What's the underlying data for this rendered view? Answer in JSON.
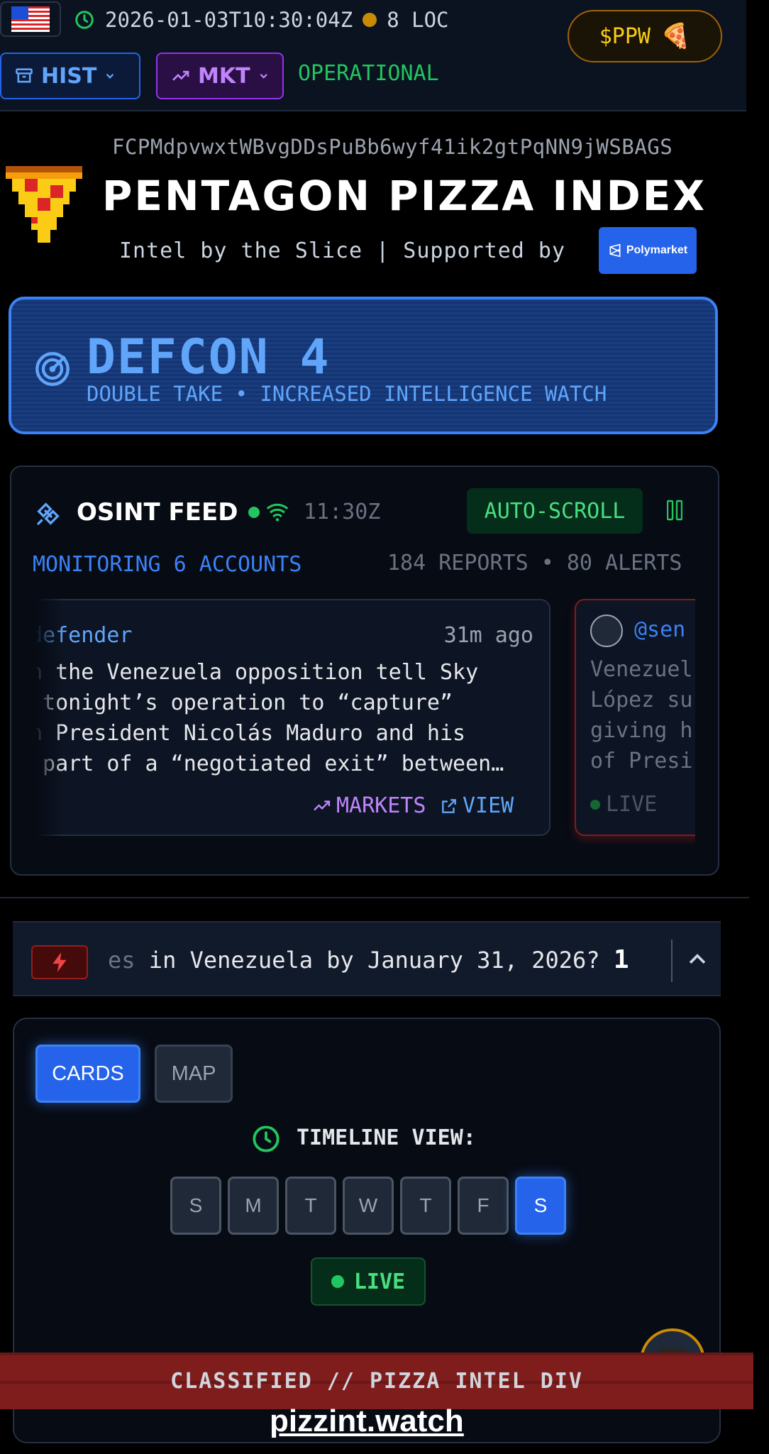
{
  "header": {
    "timestamp": "2026-01-03T10:30:04Z",
    "locations": "8 LOC",
    "token_button": "$PPW",
    "hist_label": "HIST",
    "mkt_label": "MKT",
    "status": "OPERATIONAL"
  },
  "brand": {
    "contract_address": "FCPMdpvwxtWBvgDDsPuBb6wyf41ik2gtPqNN9jWSBAGS",
    "title": "PENTAGON PIZZA INDEX",
    "tagline": "Intel by the Slice | Supported by",
    "sponsor": "Polymarket"
  },
  "defcon": {
    "level": "DEFCON 4",
    "description": "DOUBLE TAKE • INCREASED INTELLIGENCE WATCH"
  },
  "osint": {
    "title": "OSINT FEED",
    "time": "11:30Z",
    "auto_scroll": "AUTO-SCROLL",
    "monitoring": "MONITORING 6 ACCOUNTS",
    "counts": "184 REPORTS • 80 ALERTS",
    "posts": [
      {
        "user": "defender",
        "time": "31m ago",
        "text": "n the Venezuela opposition tell Sky\n tonight’s operation to “capture”\nn President Nicolás Maduro and his\n part of a “negotiated exit” between…",
        "markets_label": "MARKETS",
        "view_label": "VIEW"
      },
      {
        "user": "@sen",
        "text": "Venezuel\nLópez su\ngiving h\nof Presi",
        "status": "LIVE"
      }
    ]
  },
  "ticker": {
    "text_faded": "es",
    "text": " in Venezuela by January 31, 2026?",
    "value": "1"
  },
  "view": {
    "cards_label": "CARDS",
    "map_label": "MAP",
    "timeline_label": "TIMELINE VIEW:",
    "days": [
      "S",
      "M",
      "T",
      "W",
      "T",
      "F",
      "S"
    ],
    "active_day_index": 6,
    "live_label": "LIVE"
  },
  "footer": {
    "banner": "CLASSIFIED // PIZZA INTEL DIV",
    "watermark": "pizzint.watch"
  },
  "colors": {
    "accent_blue": "#3b82f6",
    "accent_green": "#22c55e",
    "accent_purple": "#c084fc",
    "banner_red": "#7f1d1d",
    "token_yellow": "#facc15"
  }
}
